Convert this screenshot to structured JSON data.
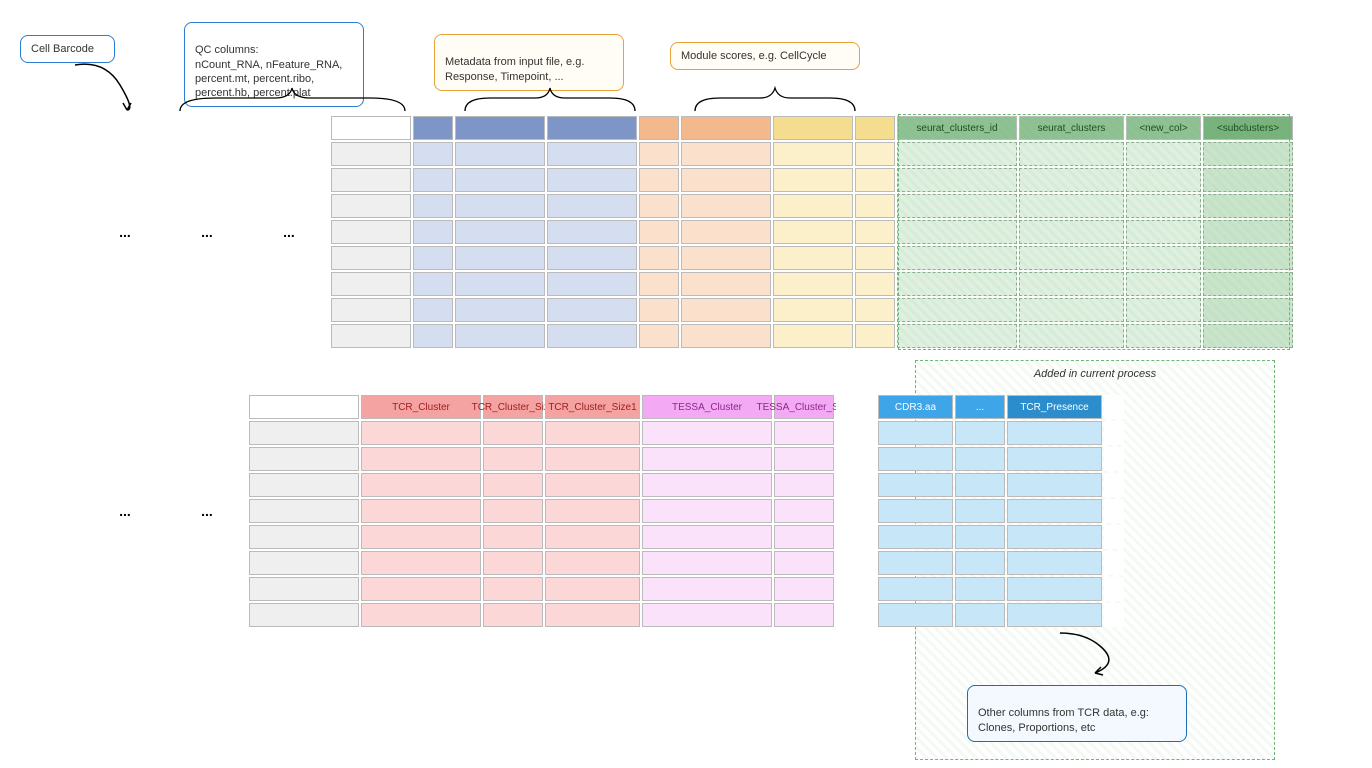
{
  "callouts": {
    "cell_barcode": "Cell Barcode",
    "qc": "QC columns:\nnCount_RNA, nFeature_RNA,\npercent.mt, percent.ribo,\npercent.hb, percent.plat",
    "metadata": "Metadata from input file, e.g.\nResponse, Timepoint, ...",
    "modules": "Module scores, e.g. CellCycle",
    "added": "Added in current process",
    "other_tcr": "Other columns from TCR data, e.g:\nClones, Proportions, etc"
  },
  "top_headers": {
    "seurat_id": "seurat_clusters_id",
    "seurat": "seurat_clusters",
    "new_col": "<new_col>",
    "subclusters": "<subclusters>"
  },
  "bottom_headers": {
    "tcr_cluster": "TCR_Cluster",
    "tcr_size": "TCR_Cluster_Size",
    "tcr_size1": "TCR_Cluster_Size1",
    "tessa_cluster": "TESSA_Cluster",
    "tessa_size": "TESSA_Cluster_Size",
    "cdr3": "CDR3.aa",
    "dots": "...",
    "tcr_presence": "TCR_Presence"
  },
  "ellipsis": "..."
}
